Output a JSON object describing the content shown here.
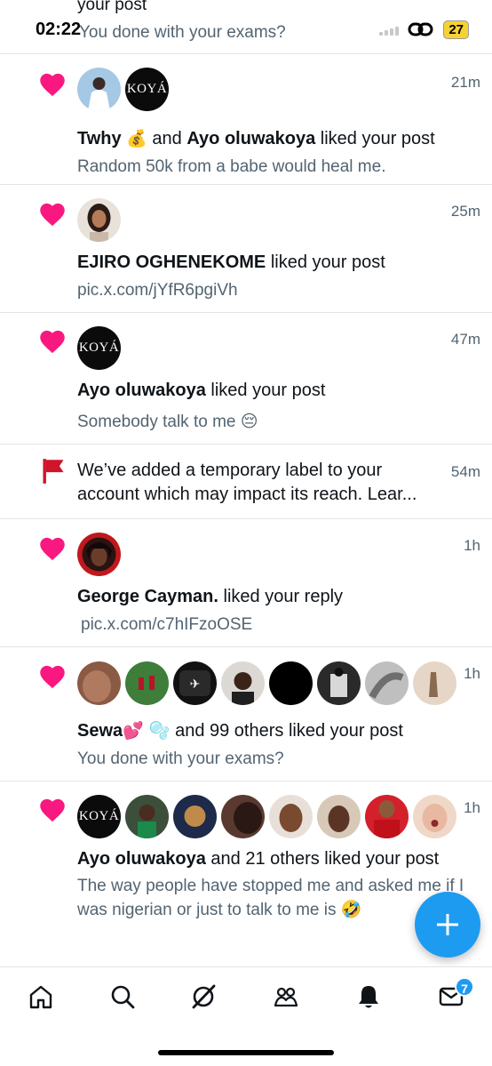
{
  "status_bar": {
    "time": "02:22",
    "battery": "27"
  },
  "top_partial": {
    "line1": "your post",
    "line2": "You done with your exams?"
  },
  "notifications": [
    {
      "time": "21m",
      "name1": "Twhy",
      "emoji1": "💰",
      "mid": " and ",
      "name2": "Ayo oluwakoya",
      "action": " liked your post",
      "text": "Random 50k from a babe would heal me."
    },
    {
      "time": "25m",
      "name1": "EJIRO OGHENEKOME",
      "action": " liked your post",
      "text": "pic.x.com/jYfR6pgiVh"
    },
    {
      "time": "47m",
      "name1": "Ayo oluwakoya",
      "action": " liked your post",
      "text": "Somebody talk to me",
      "emoji": "😔"
    },
    {
      "time": "54m",
      "line1": "We’ve added a temporary label to your",
      "line2": "account which may impact its reach. Lear..."
    },
    {
      "time": "1h",
      "name1": "George Cayman.",
      "action": " liked your reply",
      "text": "pic.x.com/c7hIFzoOSE"
    },
    {
      "time": "1h",
      "name1": "Sewa",
      "emoji1": "💕 🫧",
      "action": " and 99 others liked your post",
      "text": "You done with your exams?"
    },
    {
      "time": "1h",
      "name1": "Ayo oluwakoya",
      "action": " and 21 others liked your post",
      "text": "The way people have stopped me and asked me if I was nigerian or just to talk to me is",
      "emoji": "🤣"
    }
  ],
  "avatar_label": "KOYÁ",
  "tabs": {
    "messages_badge": "7"
  },
  "colors": {
    "heart": "#f91880",
    "flag": "#d0142a",
    "accent": "#1d9bf0",
    "secondary_text": "#536471"
  }
}
